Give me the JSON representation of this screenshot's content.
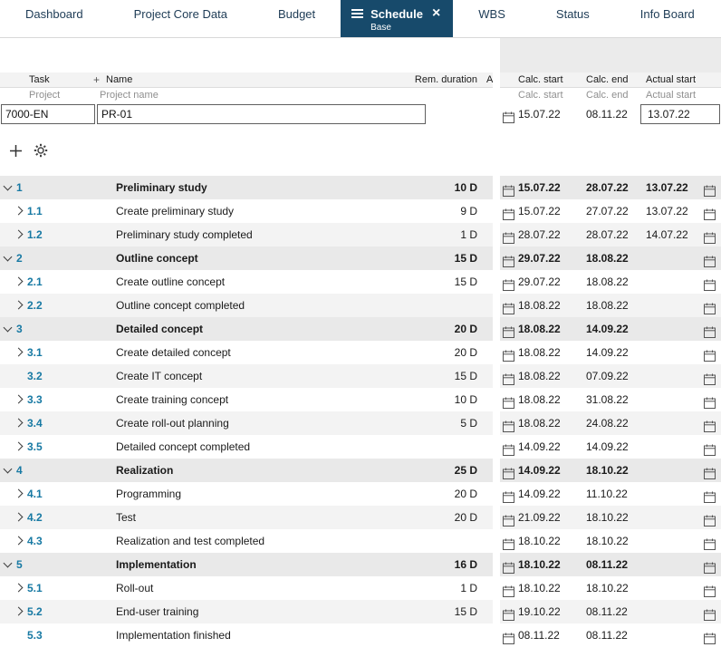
{
  "tabs": [
    {
      "label": "Dashboard",
      "active": false
    },
    {
      "label": "Project Core Data",
      "active": false
    },
    {
      "label": "Budget",
      "active": false
    },
    {
      "label": "Schedule",
      "active": true,
      "sublabel": "Base",
      "closable": true
    },
    {
      "label": "WBS",
      "active": false
    },
    {
      "label": "Status",
      "active": false
    },
    {
      "label": "Info Board",
      "active": false
    }
  ],
  "icons": {
    "add_column": "+",
    "close_tab": "×"
  },
  "header": {
    "col_task": "Task",
    "col_name": "Name",
    "col_rem_duration": "Rem. duration",
    "col_a": "A",
    "col_calc_start": "Calc. start",
    "col_calc_end": "Calc. end",
    "col_actual_start": "Actual start",
    "sub_project": "Project",
    "sub_project_name": "Project name",
    "sub_calc_start": "Calc. start",
    "sub_calc_end": "Calc. end",
    "sub_actual_start": "Actual start"
  },
  "project": {
    "id_value": "7000-EN",
    "name_value": "PR-01",
    "calc_start": "15.07.22",
    "calc_end": "08.11.22",
    "actual_start": "13.07.22"
  },
  "colors": {
    "accent_navy": "#174A6B",
    "task_number": "#1779A3",
    "group_row_bg": "#e9e9e9",
    "alt_row_bg": "#f3f3f3",
    "header_bg": "#f3f3f3",
    "subheader_text": "#8f8f8f",
    "gantt_placeholder_bg": "#ebebeb"
  },
  "tasks": [
    {
      "num": "1",
      "name": "Preliminary study",
      "duration": "10 D",
      "calc_start": "15.07.22",
      "calc_end": "28.07.22",
      "actual_start": "13.07.22",
      "group": true,
      "chevron": "down"
    },
    {
      "num": "1.1",
      "name": "Create preliminary study",
      "duration": "9 D",
      "calc_start": "15.07.22",
      "calc_end": "27.07.22",
      "actual_start": "13.07.22",
      "group": false,
      "chevron": "right"
    },
    {
      "num": "1.2",
      "name": "Preliminary study completed",
      "duration": "1 D",
      "calc_start": "28.07.22",
      "calc_end": "28.07.22",
      "actual_start": "14.07.22",
      "group": false,
      "chevron": "right"
    },
    {
      "num": "2",
      "name": "Outline concept",
      "duration": "15 D",
      "calc_start": "29.07.22",
      "calc_end": "18.08.22",
      "actual_start": "",
      "group": true,
      "chevron": "down"
    },
    {
      "num": "2.1",
      "name": "Create outline concept",
      "duration": "15 D",
      "calc_start": "29.07.22",
      "calc_end": "18.08.22",
      "actual_start": "",
      "group": false,
      "chevron": "right"
    },
    {
      "num": "2.2",
      "name": "Outline concept completed",
      "duration": "",
      "calc_start": "18.08.22",
      "calc_end": "18.08.22",
      "actual_start": "",
      "group": false,
      "chevron": "right"
    },
    {
      "num": "3",
      "name": "Detailed concept",
      "duration": "20 D",
      "calc_start": "18.08.22",
      "calc_end": "14.09.22",
      "actual_start": "",
      "group": true,
      "chevron": "down"
    },
    {
      "num": "3.1",
      "name": "Create detailed concept",
      "duration": "20 D",
      "calc_start": "18.08.22",
      "calc_end": "14.09.22",
      "actual_start": "",
      "group": false,
      "chevron": "right"
    },
    {
      "num": "3.2",
      "name": "Create IT concept",
      "duration": "15 D",
      "calc_start": "18.08.22",
      "calc_end": "07.09.22",
      "actual_start": "",
      "group": false,
      "chevron": "none"
    },
    {
      "num": "3.3",
      "name": "Create training concept",
      "duration": "10 D",
      "calc_start": "18.08.22",
      "calc_end": "31.08.22",
      "actual_start": "",
      "group": false,
      "chevron": "right"
    },
    {
      "num": "3.4",
      "name": "Create roll-out planning",
      "duration": "5 D",
      "calc_start": "18.08.22",
      "calc_end": "24.08.22",
      "actual_start": "",
      "group": false,
      "chevron": "right"
    },
    {
      "num": "3.5",
      "name": "Detailed concept completed",
      "duration": "",
      "calc_start": "14.09.22",
      "calc_end": "14.09.22",
      "actual_start": "",
      "group": false,
      "chevron": "right"
    },
    {
      "num": "4",
      "name": "Realization",
      "duration": "25 D",
      "calc_start": "14.09.22",
      "calc_end": "18.10.22",
      "actual_start": "",
      "group": true,
      "chevron": "down"
    },
    {
      "num": "4.1",
      "name": "Programming",
      "duration": "20 D",
      "calc_start": "14.09.22",
      "calc_end": "11.10.22",
      "actual_start": "",
      "group": false,
      "chevron": "right"
    },
    {
      "num": "4.2",
      "name": "Test",
      "duration": "20 D",
      "calc_start": "21.09.22",
      "calc_end": "18.10.22",
      "actual_start": "",
      "group": false,
      "chevron": "right"
    },
    {
      "num": "4.3",
      "name": "Realization and test completed",
      "duration": "",
      "calc_start": "18.10.22",
      "calc_end": "18.10.22",
      "actual_start": "",
      "group": false,
      "chevron": "right"
    },
    {
      "num": "5",
      "name": "Implementation",
      "duration": "16 D",
      "calc_start": "18.10.22",
      "calc_end": "08.11.22",
      "actual_start": "",
      "group": true,
      "chevron": "down"
    },
    {
      "num": "5.1",
      "name": "Roll-out",
      "duration": "1 D",
      "calc_start": "18.10.22",
      "calc_end": "18.10.22",
      "actual_start": "",
      "group": false,
      "chevron": "right"
    },
    {
      "num": "5.2",
      "name": "End-user training",
      "duration": "15 D",
      "calc_start": "19.10.22",
      "calc_end": "08.11.22",
      "actual_start": "",
      "group": false,
      "chevron": "right"
    },
    {
      "num": "5.3",
      "name": "Implementation finished",
      "duration": "",
      "calc_start": "08.11.22",
      "calc_end": "08.11.22",
      "actual_start": "",
      "group": false,
      "chevron": "none"
    }
  ]
}
